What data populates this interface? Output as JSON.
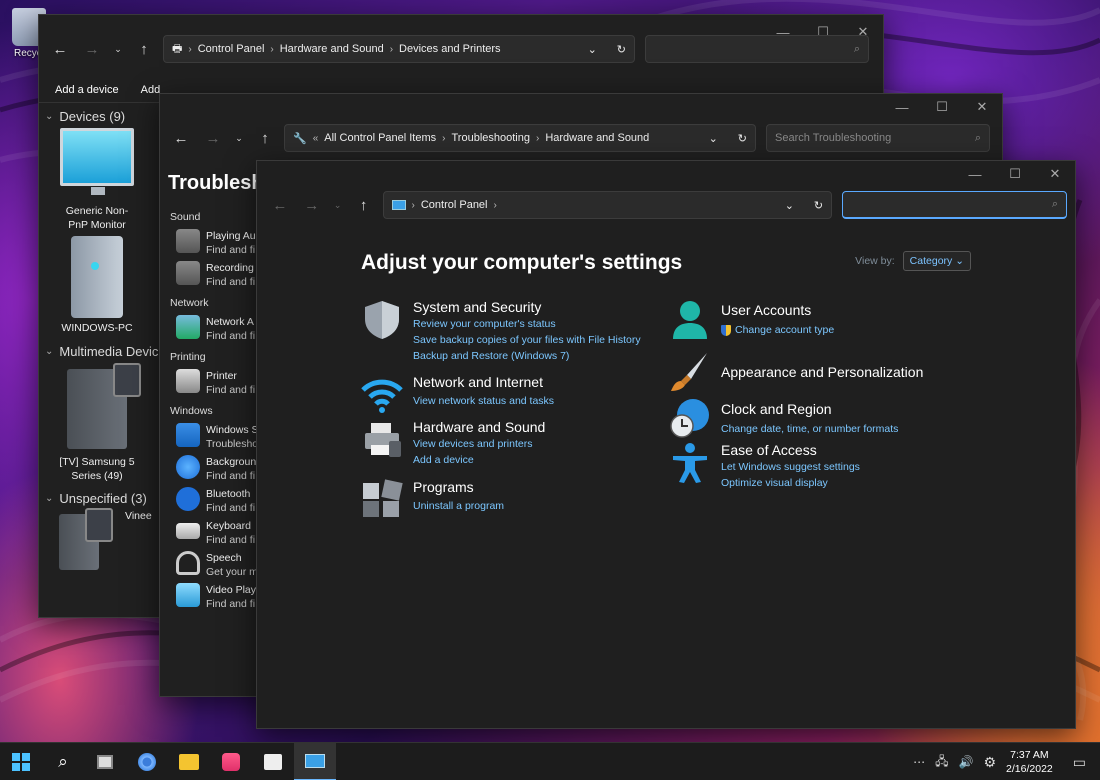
{
  "desktop": {
    "recycle_label": "Recycl"
  },
  "devices_window": {
    "address": [
      "Control Panel",
      "Hardware and Sound",
      "Devices and Printers"
    ],
    "commands": [
      "Add a device",
      "Add"
    ],
    "groups": [
      {
        "label": "Devices (9)",
        "items": [
          "Generic Non-PnP Monitor",
          "WINDOWS-PC"
        ]
      },
      {
        "label": "Multimedia Devic",
        "items": [
          "[TV] Samsung 5 Series (49)"
        ]
      },
      {
        "label": "Unspecified (3)",
        "items": [
          "Vinee"
        ]
      }
    ]
  },
  "troubleshoot_window": {
    "address": [
      "All Control Panel Items",
      "Troubleshooting",
      "Hardware and Sound"
    ],
    "search_placeholder": "Search Troubleshooting",
    "title": "Troublesh",
    "sections": [
      {
        "label": "Sound",
        "items": [
          {
            "title": "Playing Au",
            "sub": "Find and fi"
          },
          {
            "title": "Recording",
            "sub": "Find and fi"
          }
        ]
      },
      {
        "label": "Network",
        "items": [
          {
            "title": "Network A",
            "sub": "Find and fi"
          }
        ]
      },
      {
        "label": "Printing",
        "items": [
          {
            "title": "Printer",
            "sub": "Find and fi"
          }
        ]
      },
      {
        "label": "Windows",
        "items": [
          {
            "title": "Windows S",
            "sub": "Troubleshoo"
          },
          {
            "title": "Backgroun",
            "sub": "Find and fi"
          },
          {
            "title": "Bluetooth",
            "sub": "Find and fi"
          },
          {
            "title": "Keyboard",
            "sub": "Find and fi"
          },
          {
            "title": "Speech",
            "sub": "Get your m"
          },
          {
            "title": "Video Play",
            "sub": "Find and fi"
          }
        ]
      }
    ]
  },
  "control_panel": {
    "address": [
      "Control Panel"
    ],
    "heading": "Adjust your computer's settings",
    "view_by_label": "View by:",
    "view_by_value": "Category",
    "categories_left": [
      {
        "title": "System and Security",
        "icon": "shield-icon",
        "links": [
          "Review your computer's status",
          "Save backup copies of your files with File History",
          "Backup and Restore (Windows 7)"
        ]
      },
      {
        "title": "Network and Internet",
        "icon": "wifi-icon",
        "links": [
          "View network status and tasks"
        ]
      },
      {
        "title": "Hardware and Sound",
        "icon": "printer-icon",
        "links": [
          "View devices and printers",
          "Add a device"
        ]
      },
      {
        "title": "Programs",
        "icon": "programs-icon",
        "links": [
          "Uninstall a program"
        ]
      }
    ],
    "categories_right": [
      {
        "title": "User Accounts",
        "icon": "user-icon",
        "links": [
          "Change account type"
        ]
      },
      {
        "title": "Appearance and Personalization",
        "icon": "paintbrush-icon",
        "links": []
      },
      {
        "title": "Clock and Region",
        "icon": "clock-globe-icon",
        "links": [
          "Change date, time, or number formats"
        ]
      },
      {
        "title": "Ease of Access",
        "icon": "accessibility-icon",
        "links": [
          "Let Windows suggest settings",
          "Optimize visual display"
        ]
      }
    ]
  },
  "taskbar": {
    "time": "7:37 AM",
    "date": "2/16/2022"
  }
}
